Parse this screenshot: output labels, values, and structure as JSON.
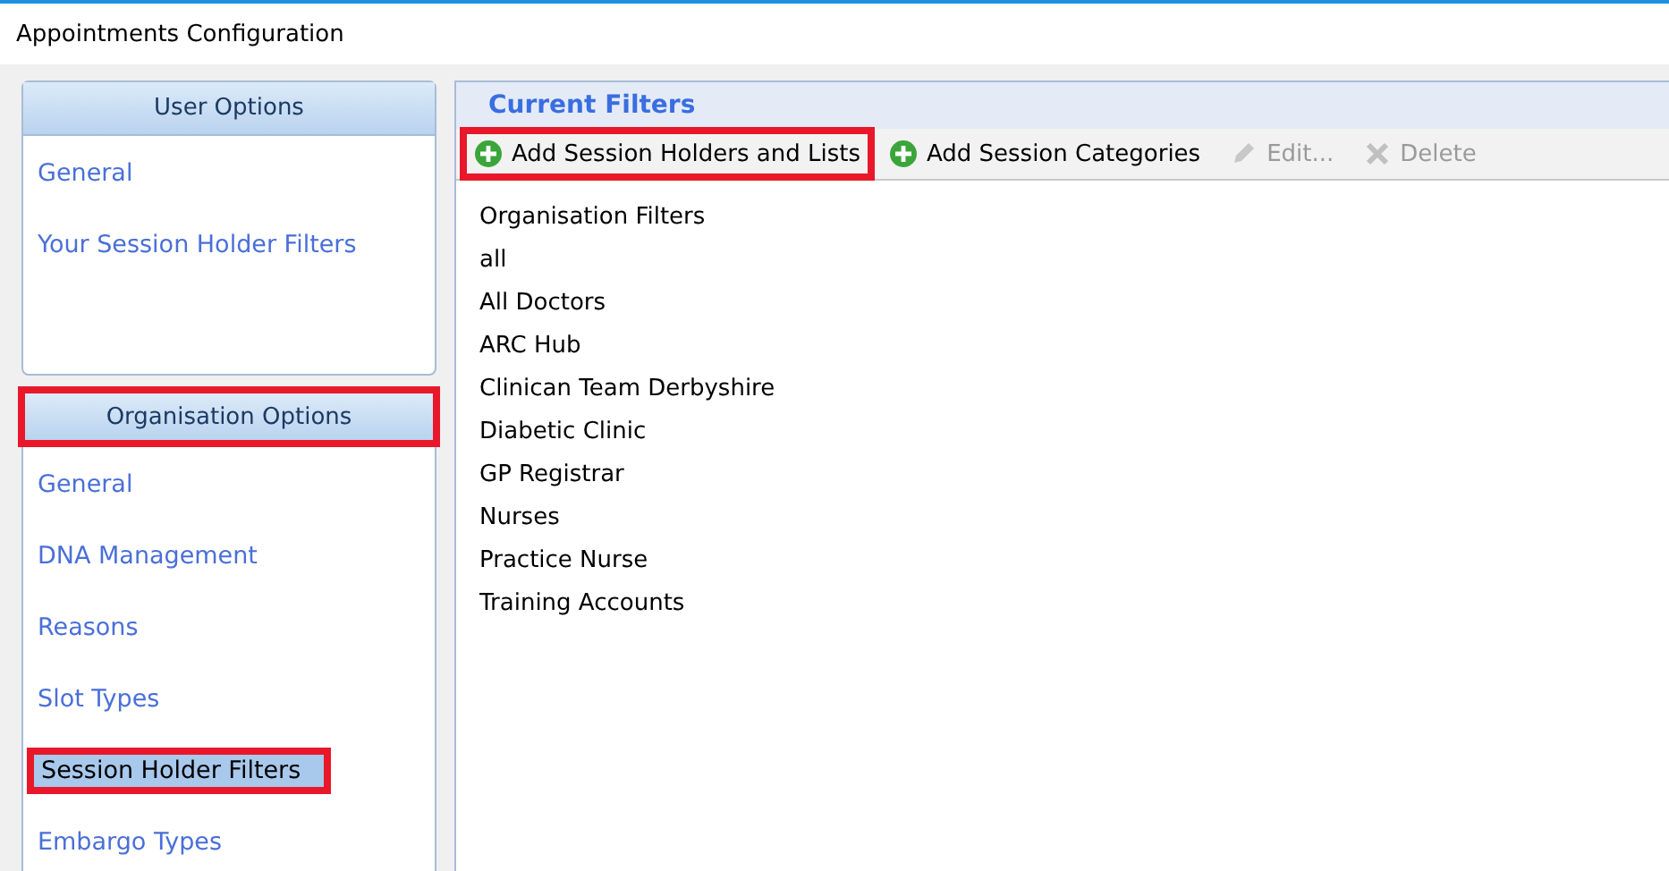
{
  "window": {
    "title": "Appointments Configuration"
  },
  "sidebar": {
    "sections": [
      {
        "title": "User Options",
        "highlighted": false,
        "items": [
          {
            "label": "General",
            "selected": false,
            "highlighted": false
          },
          {
            "label": "Your Session Holder Filters",
            "selected": false,
            "highlighted": false
          }
        ]
      },
      {
        "title": "Organisation Options",
        "highlighted": true,
        "items": [
          {
            "label": "General",
            "selected": false,
            "highlighted": false
          },
          {
            "label": "DNA Management",
            "selected": false,
            "highlighted": false
          },
          {
            "label": "Reasons",
            "selected": false,
            "highlighted": false
          },
          {
            "label": "Slot Types",
            "selected": false,
            "highlighted": false
          },
          {
            "label": "Session Holder Filters",
            "selected": true,
            "highlighted": true
          },
          {
            "label": "Embargo Types",
            "selected": false,
            "highlighted": false
          }
        ]
      }
    ]
  },
  "panel": {
    "title": "Current Filters",
    "toolbar": [
      {
        "kind": "add",
        "label": "Add Session Holders and Lists",
        "disabled": false,
        "highlighted": true
      },
      {
        "kind": "add",
        "label": "Add Session Categories",
        "disabled": false,
        "highlighted": false
      },
      {
        "kind": "edit",
        "label": "Edit...",
        "disabled": true,
        "highlighted": false
      },
      {
        "kind": "delete",
        "label": "Delete",
        "disabled": true,
        "highlighted": false
      }
    ],
    "list": {
      "heading": "Organisation Filters",
      "items": [
        "all",
        "All Doctors",
        "ARC Hub",
        "Clinican Team Derbyshire",
        "Diabetic Clinic",
        "GP Registrar",
        "Nurses",
        "Practice Nurse",
        "Training Accounts"
      ]
    }
  }
}
